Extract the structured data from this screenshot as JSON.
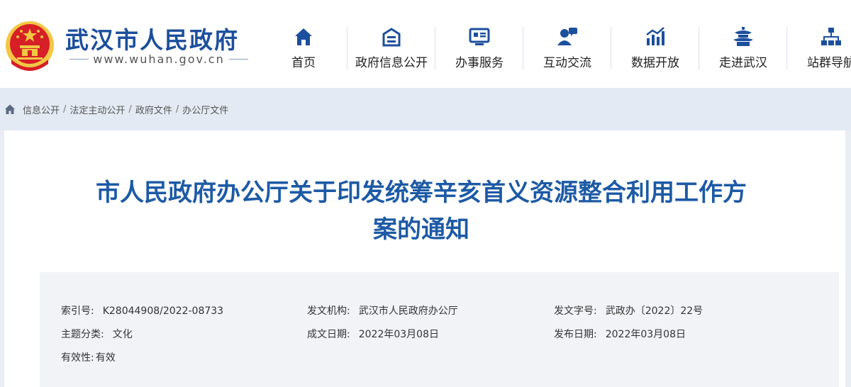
{
  "site": {
    "title": "武汉市人民政府",
    "url": "www.wuhan.gov.cn"
  },
  "nav": [
    {
      "label": "首页",
      "icon": "home-icon"
    },
    {
      "label": "政府信息公开",
      "icon": "info-public-icon"
    },
    {
      "label": "办事服务",
      "icon": "service-icon"
    },
    {
      "label": "互动交流",
      "icon": "interaction-icon"
    },
    {
      "label": "数据开放",
      "icon": "data-chart-icon"
    },
    {
      "label": "走进武汉",
      "icon": "pavilion-icon"
    },
    {
      "label": "站群导航",
      "icon": "sitemap-icon"
    }
  ],
  "breadcrumb": [
    "信息公开",
    "法定主动公开",
    "政府文件",
    "办公厅文件"
  ],
  "document": {
    "title_line1": "市人民政府办公厅关于印发统筹辛亥首义资源整合利用工作方",
    "title_line2": "案的通知",
    "meta": {
      "index_label": "索引号:",
      "index_value": "K28044908/2022-08733",
      "issuer_label": "发文机构:",
      "issuer_value": "武汉市人民政府办公厅",
      "docno_label": "发文字号:",
      "docno_value": "武政办〔2022〕22号",
      "topic_label": "主题分类:",
      "topic_value": "文化",
      "created_label": "成文日期:",
      "created_value": "2022年03月08日",
      "published_label": "发布日期:",
      "published_value": "2022年03月08日",
      "validity_label": "有效性:",
      "validity_value": "有效"
    }
  },
  "colors": {
    "brand_blue": "#1c4f9c",
    "title_blue": "#1d5aa5",
    "emblem_red": "#d61f26",
    "emblem_gold": "#f2c744"
  }
}
